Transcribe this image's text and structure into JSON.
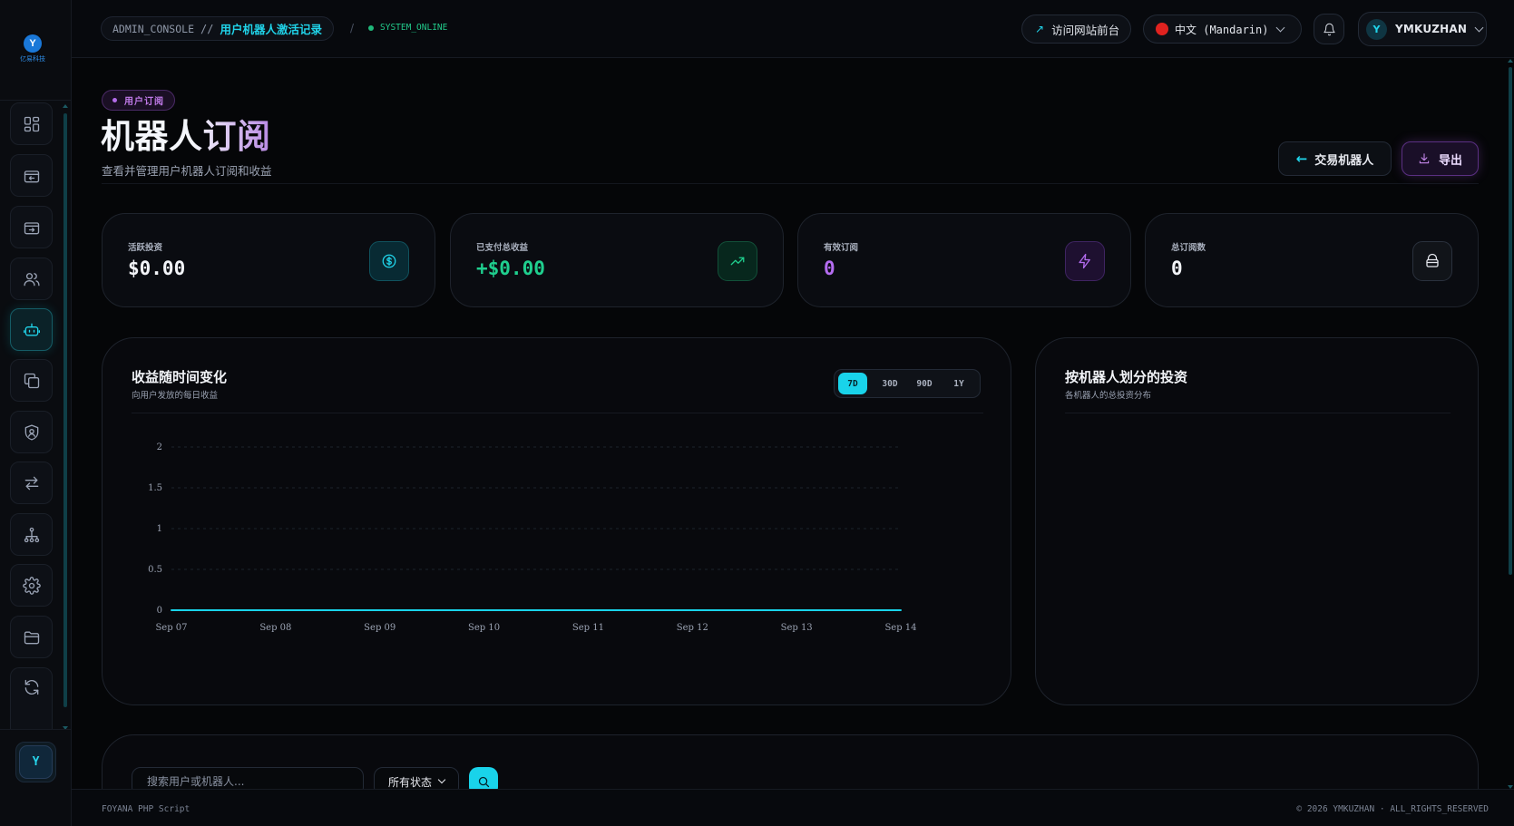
{
  "sidebar": {
    "logo_mark": "Y",
    "logo_text": "亿易科技",
    "items": [
      "dashboard",
      "deposits",
      "withdrawals",
      "users",
      "trading-bots",
      "copy",
      "security",
      "transfers",
      "network",
      "settings",
      "files",
      "sync"
    ],
    "avatar": "Y"
  },
  "header": {
    "breadcrumb_root": "ADMIN_CONSOLE",
    "breadcrumb_sep": "//",
    "breadcrumb_current": "用户机器人激活记录",
    "slash": "/",
    "status": "SYSTEM_ONLINE",
    "visit_label": "访问网站前台",
    "language": "中文 (Mandarin)",
    "user_initial": "Y",
    "username": "YMKUZHAN"
  },
  "page": {
    "tag": "用户订阅",
    "title": "机器人订阅",
    "subtitle": "查看并管理用户机器人订阅和收益",
    "back_button": "交易机器人",
    "export_button": "导出"
  },
  "stats": [
    {
      "label": "活跃投资",
      "value": "$0.00",
      "color": "#f2f4f8",
      "icon": "dollar-icon"
    },
    {
      "label": "已支付总收益",
      "value": "+$0.00",
      "color": "#1fcf8e",
      "icon": "trending-up-icon"
    },
    {
      "label": "有效订阅",
      "value": "0",
      "color": "#b46cf0",
      "icon": "zap-icon"
    },
    {
      "label": "总订阅数",
      "value": "0",
      "color": "#f2f4f8",
      "icon": "box-icon"
    }
  ],
  "revenue_card": {
    "title": "收益随时间变化",
    "subtitle": "向用户发放的每日收益",
    "ranges": [
      "7D",
      "30D",
      "90D",
      "1Y"
    ],
    "selected_range": "7D"
  },
  "invest_card": {
    "title": "按机器人划分的投资",
    "subtitle": "各机器人的总投资分布"
  },
  "chart_data": {
    "type": "line",
    "x": [
      "Sep 07",
      "Sep 08",
      "Sep 09",
      "Sep 10",
      "Sep 11",
      "Sep 12",
      "Sep 13",
      "Sep 14"
    ],
    "series": [
      {
        "values": [
          0,
          0,
          0,
          0,
          0,
          0,
          0,
          0
        ],
        "color": "#19d3ea"
      }
    ],
    "y_ticks": [
      "0",
      "0.5",
      "1",
      "1.5",
      "2"
    ],
    "ylim": [
      0,
      2
    ],
    "grid": true
  },
  "filters": {
    "search_placeholder": "搜索用户或机器人...",
    "status_select": "所有状态"
  },
  "footer": {
    "left": "FOYANA PHP Script",
    "right": "© 2026 YMKUZHAN · ALL_RIGHTS_RESERVED"
  }
}
